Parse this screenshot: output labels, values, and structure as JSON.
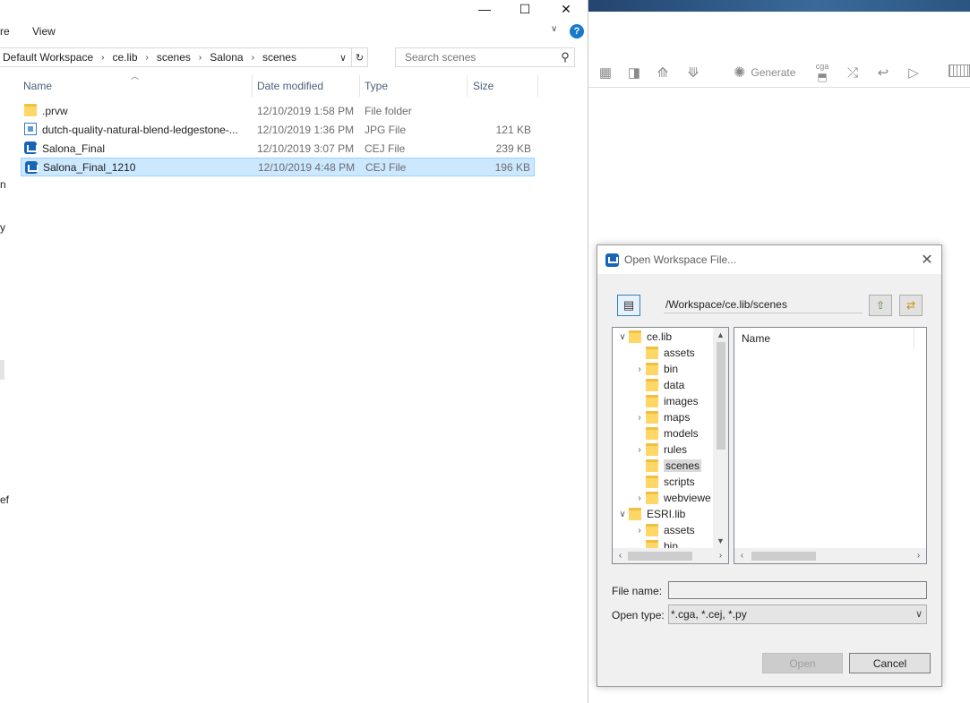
{
  "explorer": {
    "ribbon": {
      "tab_partial": "re",
      "tab_view": "View"
    },
    "window_controls": {
      "minimize": "—",
      "maximize": "☐",
      "close": "✕"
    },
    "address": {
      "crumbs": [
        "Default Workspace",
        "ce.lib",
        "scenes",
        "Salona",
        "scenes"
      ],
      "sep": "›"
    },
    "search": {
      "placeholder": "Search scenes"
    },
    "columns": {
      "name": "Name",
      "date": "Date modified",
      "type": "Type",
      "size": "Size"
    },
    "files": [
      {
        "name": ".prvw",
        "date": "12/10/2019 1:58 PM",
        "type": "File folder",
        "size": "",
        "icon": "folder-icon"
      },
      {
        "name": "dutch-quality-natural-blend-ledgestone-...",
        "date": "12/10/2019 1:36 PM",
        "type": "JPG File",
        "size": "121 KB",
        "icon": "jpg-file-icon"
      },
      {
        "name": "Salona_Final",
        "date": "12/10/2019 3:07 PM",
        "type": "CEJ File",
        "size": "239 KB",
        "icon": "cej-file-icon"
      },
      {
        "name": "Salona_Final_1210",
        "date": "12/10/2019 4:48 PM",
        "type": "CEJ File",
        "size": "196 KB",
        "icon": "cej-file-icon"
      }
    ],
    "left_edge_text": [
      "n",
      "y",
      "ef"
    ]
  },
  "cityengine": {
    "toolbar": {
      "generate_label": "Generate",
      "cga_label": "cga"
    }
  },
  "dialog": {
    "title": "Open Workspace File...",
    "path": "/Workspace/ce.lib/scenes",
    "tree": [
      {
        "label": "ce.lib",
        "level": 0,
        "twisty": "expanded"
      },
      {
        "label": "assets",
        "level": 1,
        "twisty": "none"
      },
      {
        "label": "bin",
        "level": 1,
        "twisty": "collapsed"
      },
      {
        "label": "data",
        "level": 1,
        "twisty": "none"
      },
      {
        "label": "images",
        "level": 1,
        "twisty": "none"
      },
      {
        "label": "maps",
        "level": 1,
        "twisty": "collapsed"
      },
      {
        "label": "models",
        "level": 1,
        "twisty": "none"
      },
      {
        "label": "rules",
        "level": 1,
        "twisty": "collapsed"
      },
      {
        "label": "scenes",
        "level": 1,
        "twisty": "none",
        "selected": true
      },
      {
        "label": "scripts",
        "level": 1,
        "twisty": "none"
      },
      {
        "label": "webviewe",
        "level": 1,
        "twisty": "collapsed"
      },
      {
        "label": "ESRI.lib",
        "level": 0,
        "twisty": "expanded"
      },
      {
        "label": "assets",
        "level": 1,
        "twisty": "collapsed"
      },
      {
        "label": "bin",
        "level": 1,
        "twisty": "none"
      }
    ],
    "list_header": "Name",
    "file_name_label": "File name:",
    "file_name_value": "",
    "open_type_label": "Open type:",
    "open_type_value": "*.cga, *.cej, *.py",
    "open_button": "Open",
    "cancel_button": "Cancel"
  }
}
